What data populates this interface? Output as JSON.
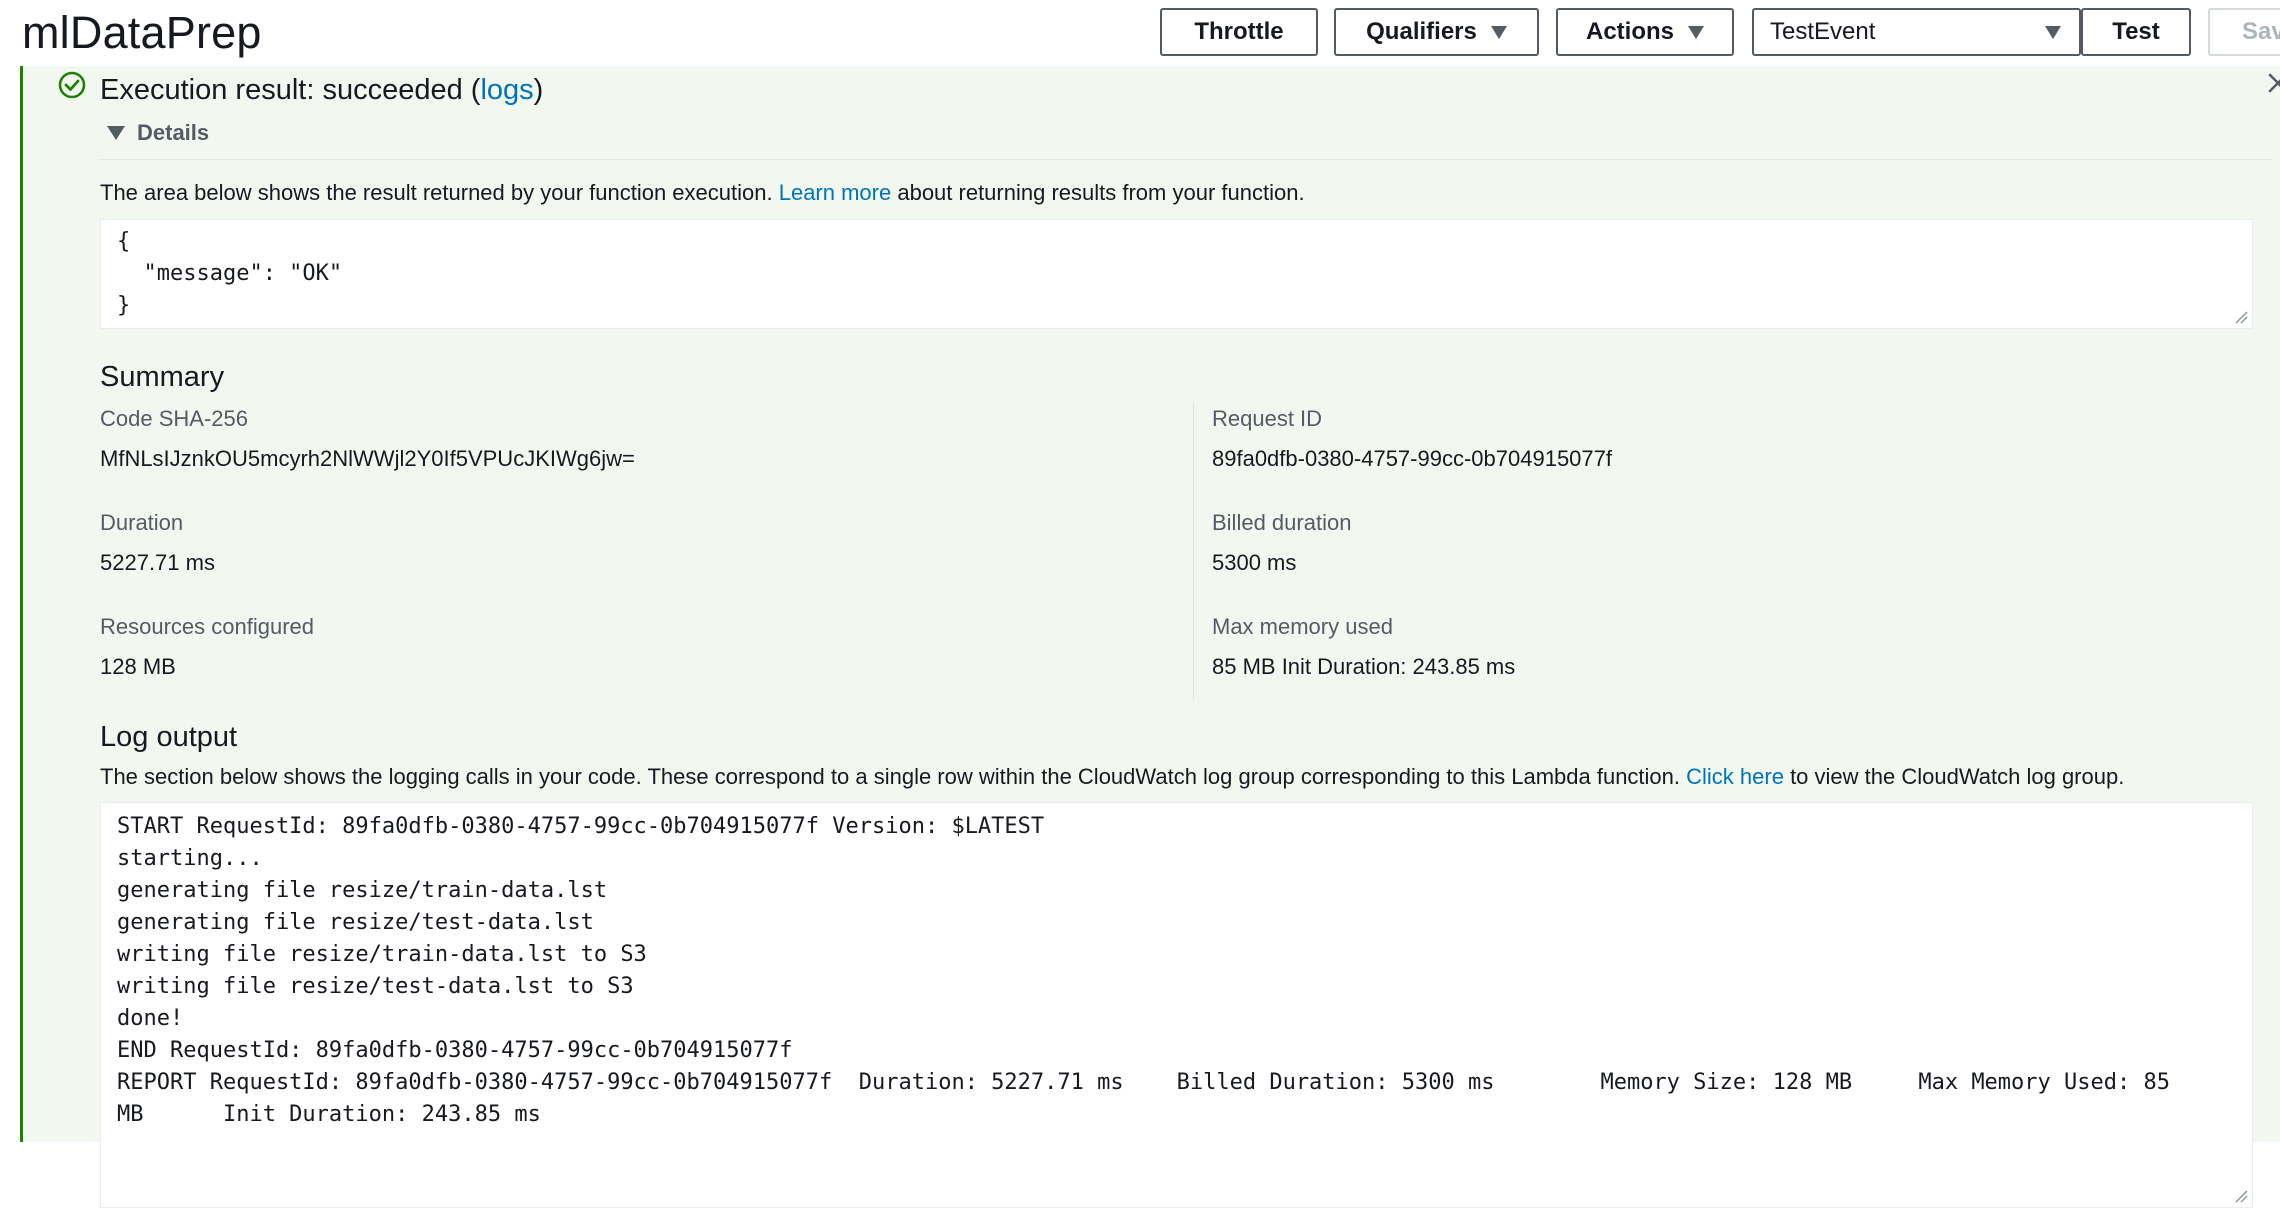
{
  "header": {
    "app_title": "mlDataPrep",
    "throttle_label": "Throttle",
    "qualifiers_label": "Qualifiers",
    "actions_label": "Actions",
    "test_event_selected": "TestEvent",
    "test_label": "Test",
    "save_label": "Sav"
  },
  "result": {
    "status_prefix": "Execution result: succeeded (",
    "logs_link": "logs",
    "status_suffix": ")",
    "details_label": "Details",
    "description_prefix": "The area below shows the result returned by your function execution. ",
    "learn_more_link": "Learn more",
    "description_suffix": " about returning results from your function.",
    "returned_json": "{\n  \"message\": \"OK\"\n}"
  },
  "summary": {
    "heading": "Summary",
    "code_sha_label": "Code SHA-256",
    "code_sha_value": "MfNLsIJznkOU5mcyrh2NlWWjl2Y0If5VPUcJKIWg6jw=",
    "request_id_label": "Request ID",
    "request_id_value": "89fa0dfb-0380-4757-99cc-0b704915077f",
    "duration_label": "Duration",
    "duration_value": "5227.71 ms",
    "billed_duration_label": "Billed duration",
    "billed_duration_value": "5300 ms",
    "resources_label": "Resources configured",
    "resources_value": "128 MB",
    "max_memory_label": "Max memory used",
    "max_memory_value": "85 MB Init Duration: 243.85 ms"
  },
  "log_output": {
    "heading": "Log output",
    "description_prefix": "The section below shows the logging calls in your code. These correspond to a single row within the CloudWatch log group corresponding to this Lambda function. ",
    "click_here_link": "Click here",
    "description_suffix": " to view the CloudWatch log group.",
    "log_text": "START RequestId: 89fa0dfb-0380-4757-99cc-0b704915077f Version: $LATEST\nstarting...\ngenerating file resize/train-data.lst\ngenerating file resize/test-data.lst\nwriting file resize/train-data.lst to S3\nwriting file resize/test-data.lst to S3\ndone!\nEND RequestId: 89fa0dfb-0380-4757-99cc-0b704915077f\nREPORT RequestId: 89fa0dfb-0380-4757-99cc-0b704915077f  Duration: 5227.71 ms    Billed Duration: 5300 ms        Memory Size: 128 MB     Max Memory Used: 85\nMB      Init Duration: 243.85 ms"
  },
  "icons": {
    "success": "check-circle-icon",
    "close": "close-icon",
    "dropdown": "caret-down-icon"
  },
  "colors": {
    "success_green": "#1d8102",
    "panel_background": "#f2f8f0",
    "link_blue": "#0073bb",
    "text": "#16191f",
    "secondary_text": "#545b64"
  }
}
